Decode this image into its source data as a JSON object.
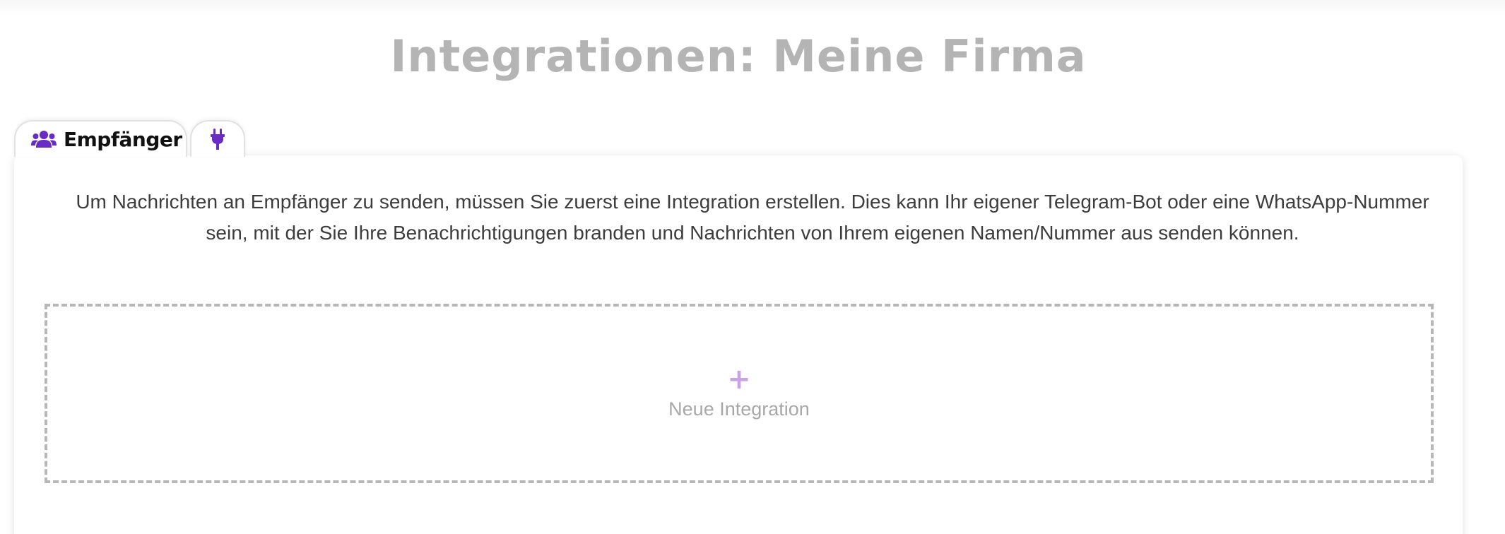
{
  "header": {
    "title": "Integrationen: Meine Firma"
  },
  "tabs": [
    {
      "label": "Empfänger",
      "icon": "users-icon",
      "active": true
    },
    {
      "label": "",
      "icon": "plug-icon",
      "active": false
    }
  ],
  "colors": {
    "accent": "#6a2bc4",
    "title": "#b4b4b4",
    "plus": "#c9a3e8"
  },
  "main": {
    "description": "Um Nachrichten an Empfänger zu senden, müssen Sie zuerst eine Integration erstellen. Dies kann Ihr eigener Telegram-Bot oder eine WhatsApp-Nummer sein, mit der Sie Ihre Benachrichtigungen branden und Nachrichten von Ihrem eigenen Namen/Nummer aus senden können.",
    "add_integration": {
      "icon": "plus-icon",
      "label": "Neue Integration"
    }
  }
}
